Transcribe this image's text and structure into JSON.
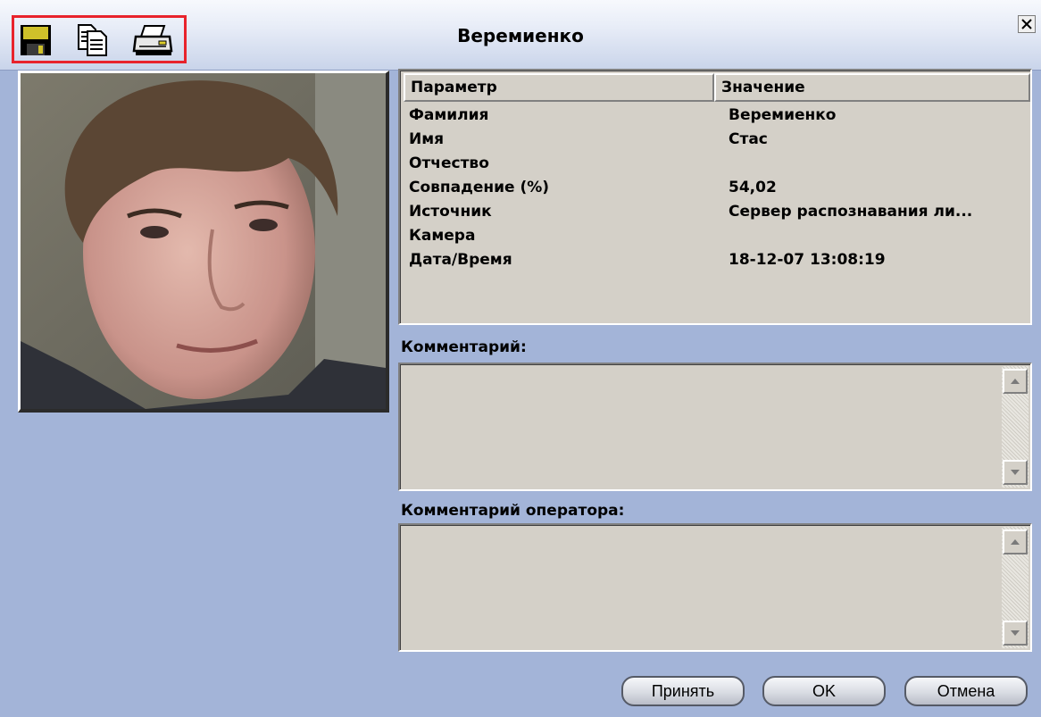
{
  "window": {
    "title": "Веремиенко"
  },
  "toolbar": {
    "icons": [
      "save-icon",
      "copy-icon",
      "print-icon"
    ]
  },
  "grid": {
    "columns": [
      "Параметр",
      "Значение"
    ],
    "rows": [
      {
        "param": "Фамилия",
        "value": "Веремиенко"
      },
      {
        "param": "Имя",
        "value": "Стас"
      },
      {
        "param": "Отчество",
        "value": ""
      },
      {
        "param": "Совпадение (%)",
        "value": "54,02"
      },
      {
        "param": "Источник",
        "value": "Сервер распознавания ли..."
      },
      {
        "param": "Камера",
        "value": ""
      },
      {
        "param": "Дата/Время",
        "value": "18-12-07 13:08:19"
      }
    ]
  },
  "comment": {
    "label": "Комментарий:",
    "value": ""
  },
  "operator_comment": {
    "label": "Комментарий оператора:",
    "value": ""
  },
  "buttons": {
    "accept": "Принять",
    "ok": "OK",
    "cancel": "Отмена"
  },
  "colors": {
    "window_bg": "#a3b4d8",
    "highlight": "#e8232c",
    "control_face": "#d4d0c8"
  }
}
